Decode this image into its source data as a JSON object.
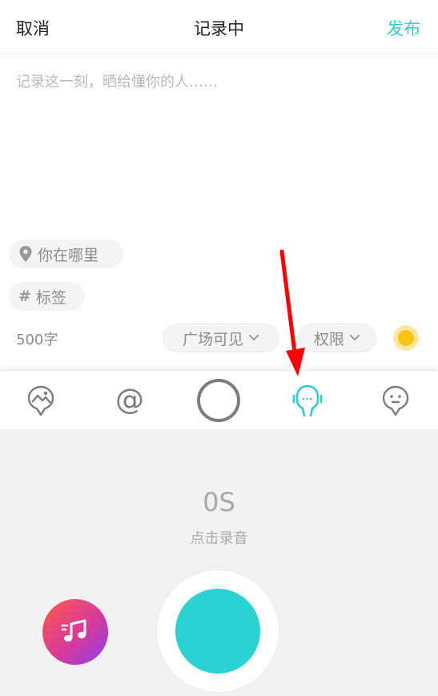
{
  "header": {
    "cancel_label": "取消",
    "title": "记录中",
    "publish_label": "发布"
  },
  "compose": {
    "placeholder": "记录这一刻，晒给懂你的人……"
  },
  "location_chip": {
    "label": "你在哪里"
  },
  "tag_chip": {
    "symbol": "#",
    "label": "标签"
  },
  "word_count": "500字",
  "visibility": {
    "label": "广场可见"
  },
  "permission": {
    "label": "权限"
  },
  "toolbar": {
    "icons": [
      "image-icon",
      "at-icon",
      "circle-icon",
      "microphone-icon",
      "emoji-icon"
    ],
    "active_index": 3
  },
  "recorder": {
    "timer": "0S",
    "hint": "点击录音"
  },
  "colors": {
    "accent": "#2ccfd0",
    "record_button": "#2bd2d3",
    "annotation_arrow": "#ff0000"
  }
}
